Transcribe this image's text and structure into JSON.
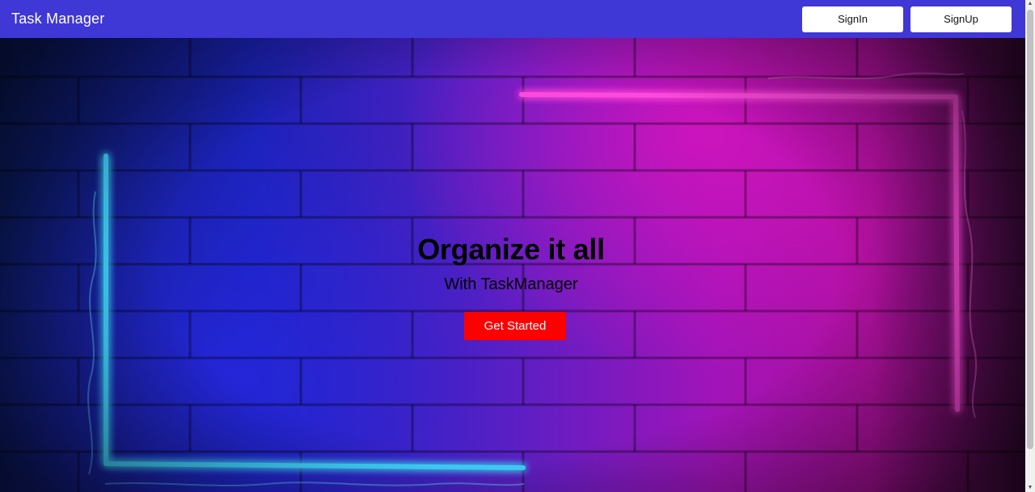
{
  "navbar": {
    "brand": "Task Manager",
    "signin_label": "SignIn",
    "signup_label": "SignUp"
  },
  "hero": {
    "title": "Organize it all",
    "subtitle": "With TaskManager",
    "cta_label": "Get Started"
  },
  "colors": {
    "navbar_bg": "#3f37d6",
    "cta_bg": "#ff0000",
    "neon_cyan": "#39d4ff",
    "neon_pink": "#ff3fd8"
  },
  "icons": {
    "scroll_up": "▲",
    "scroll_down": "▼"
  }
}
